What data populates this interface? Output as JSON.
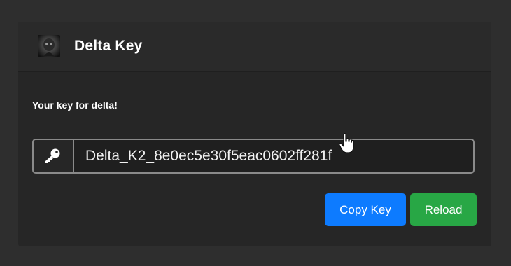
{
  "header": {
    "logo_icon": "dark-logo-avatar-icon",
    "title": "Delta Key"
  },
  "main": {
    "subtitle": "Your key for delta!",
    "key_field": {
      "icon": "key-icon",
      "value": "Delta_K2_8e0ec5e30f5eac0602ff281f"
    },
    "buttons": {
      "copy_label": "Copy Key",
      "reload_label": "Reload"
    }
  },
  "colors": {
    "page_background": "#2e2e2e",
    "card_background": "#262626",
    "copy_button": "#0d7bff",
    "reload_button": "#28a745",
    "field_border": "#8a8a8a"
  }
}
